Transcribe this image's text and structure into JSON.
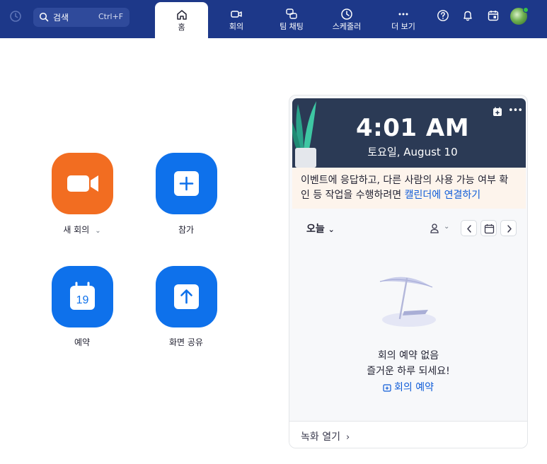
{
  "colors": {
    "topbar": "#1d3889",
    "accent_blue": "#0e71eb",
    "accent_orange": "#f26d21",
    "link": "#0e5bd8",
    "online": "#33c04a"
  },
  "topbar": {
    "search": {
      "placeholder": "검색",
      "shortcut": "Ctrl+F",
      "icon": "search-icon"
    },
    "history_icon": "clock-history-icon",
    "tabs": [
      {
        "label": "홈",
        "icon": "home-icon",
        "active": true
      },
      {
        "label": "회의",
        "icon": "video-icon",
        "active": false
      },
      {
        "label": "팀 채팅",
        "icon": "chat-icon",
        "active": false
      },
      {
        "label": "스케줄러",
        "icon": "clock-icon",
        "active": false
      },
      {
        "label": "더 보기",
        "icon": "more-icon",
        "active": false
      }
    ],
    "right_icons": [
      "help-icon",
      "bell-icon",
      "calendar-app-icon",
      "avatar"
    ]
  },
  "actions": [
    {
      "label": "새 회의",
      "icon": "video-camera-icon",
      "color": "orange",
      "has_dropdown": true
    },
    {
      "label": "참가",
      "icon": "plus-icon",
      "color": "blue"
    },
    {
      "label": "예약",
      "icon": "calendar-icon",
      "calendar_day": "19",
      "color": "blue"
    },
    {
      "label": "화면 공유",
      "icon": "share-up-arrow-icon",
      "color": "blue"
    }
  ],
  "panel": {
    "clock": {
      "time": "4:01 AM",
      "date": "토요일, August 10"
    },
    "notice": {
      "text": "이벤트에 응답하고, 다른 사람의 사용 가능 여부 확인 등 작업을 수행하려면 ",
      "link": "캘린더에 연결하기"
    },
    "today": "오늘",
    "empty": {
      "title": "회의 예약 없음",
      "subtitle": "즐거운 하루 되세요!",
      "link": "회의 예약"
    },
    "recordings": "녹화 열기"
  }
}
